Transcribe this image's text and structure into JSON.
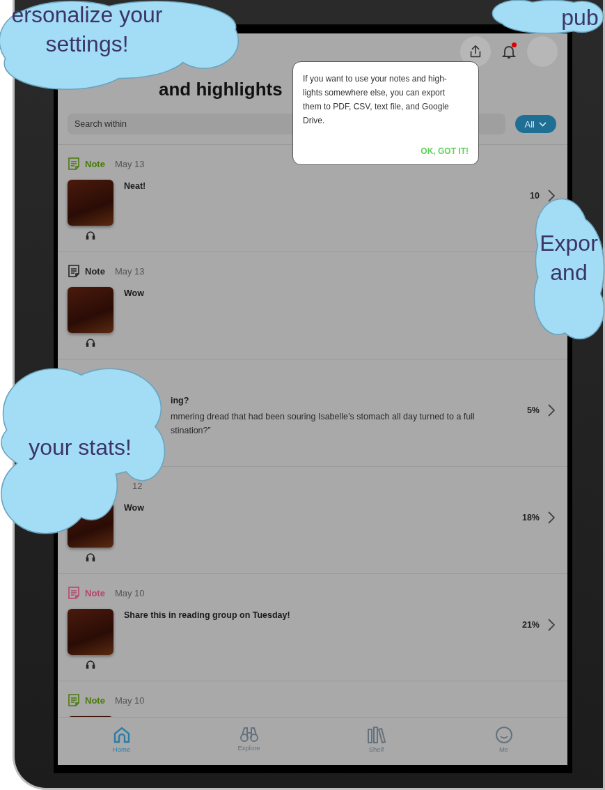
{
  "toolbar": {
    "notification_badge": true
  },
  "title": "and highlights",
  "search": {
    "placeholder": "Search within"
  },
  "filter": {
    "label": "All"
  },
  "tooltip": {
    "text": "If you want to use your notes and high-lights somewhere else, you can export them to PDF, CSV, text file, and Google Drive.",
    "button": "OK, GOT IT!"
  },
  "entries": [
    {
      "kind": "note",
      "label": "Note",
      "color": "#4a7a08",
      "date": "May 13",
      "text": "Neat!",
      "progress": "10"
    },
    {
      "kind": "note",
      "label": "Note",
      "color": "#222222",
      "date": "May 13",
      "text": "Wow"
    },
    {
      "kind": "highlight",
      "text": "ing?",
      "quote": "mmering dread that had been souring Isabelle’s stomach all day turned to a full stination?”",
      "progress": "5%"
    },
    {
      "kind": "note",
      "date": "12",
      "text": "Wow",
      "progress": "18%"
    },
    {
      "kind": "note",
      "label": "Note",
      "color": "#b8436e",
      "date": "May 10",
      "text": "Share this in reading group on Tuesday!",
      "progress": "21%"
    },
    {
      "kind": "note",
      "label": "Note",
      "color": "#4a7a08",
      "date": "May 10"
    }
  ],
  "nav": [
    {
      "label": "Home",
      "selected": true
    },
    {
      "label": "Explore",
      "selected": false
    },
    {
      "label": "Shelf",
      "selected": false
    },
    {
      "label": "Me",
      "selected": false
    }
  ],
  "callouts": [
    {
      "lines": [
        "ersonalize your",
        "settings!"
      ]
    },
    {
      "lines": [
        "pub"
      ]
    },
    {
      "lines": [
        "Expor",
        "and"
      ]
    },
    {
      "lines": [
        "your stats!"
      ]
    }
  ]
}
